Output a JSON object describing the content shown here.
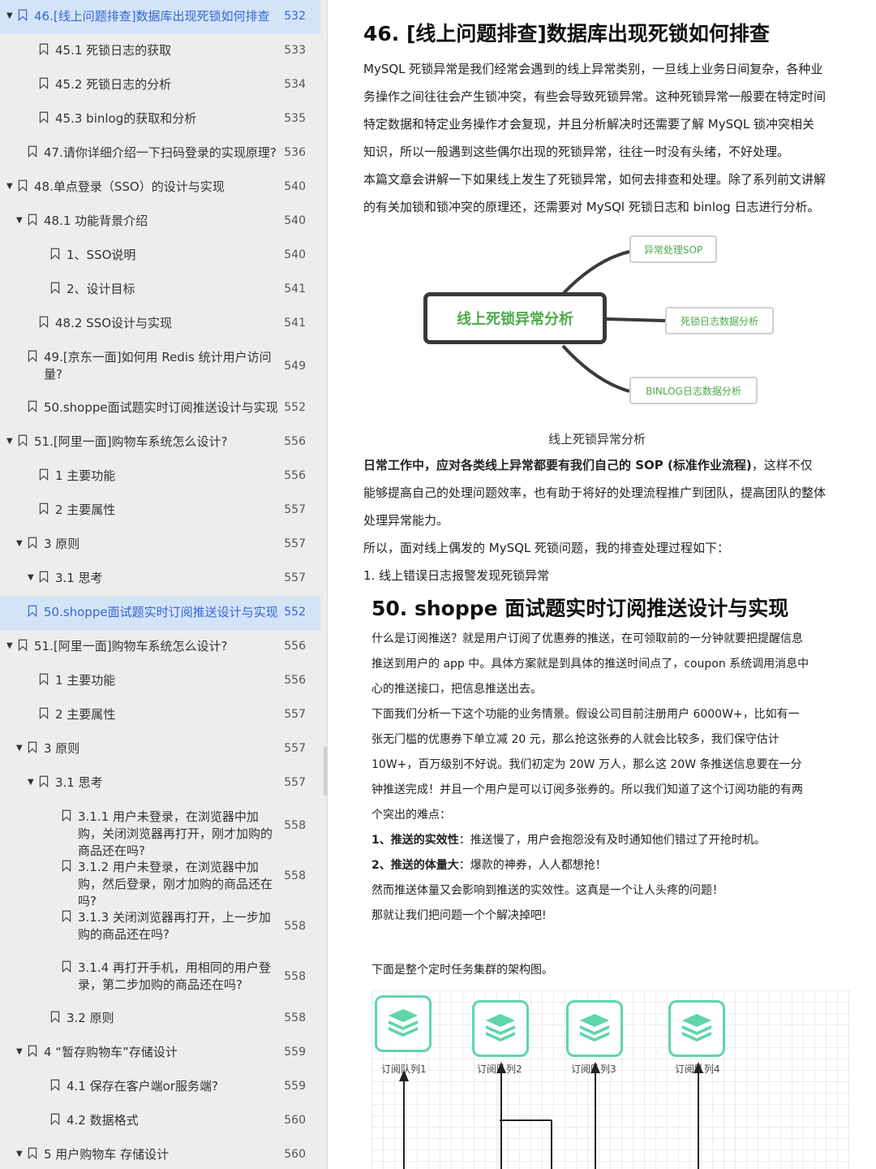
{
  "toc": [
    {
      "label": "46.[线上问题排查]数据库出现死锁如何排查",
      "page": "532",
      "level": 0,
      "arrow": "▼",
      "active": true
    },
    {
      "label": "45.1 死锁日志的获取",
      "page": "533",
      "level": 2
    },
    {
      "label": "45.2 死锁日志的分析",
      "page": "534",
      "level": 2
    },
    {
      "label": "45.3 binlog的获取和分析",
      "page": "535",
      "level": 2
    },
    {
      "label": "47.请你详细介绍一下扫码登录的实现原理?",
      "page": "536",
      "level": 1
    },
    {
      "label": "48.单点登录（SSO）的设计与实现",
      "page": "540",
      "level": 0,
      "arrow": "▼"
    },
    {
      "label": "48.1 功能背景介绍",
      "page": "540",
      "level": 1,
      "arrow": "▼"
    },
    {
      "label": "1、SSO说明",
      "page": "540",
      "level": 3
    },
    {
      "label": "2、设计目标",
      "page": "541",
      "level": 3
    },
    {
      "label": "48.2 SSO设计与实现",
      "page": "541",
      "level": 2
    },
    {
      "label": "49.[京东一面]如何用 Redis 统计用户访问量?",
      "page": "549",
      "level": 1,
      "wrap": true
    },
    {
      "label": "50.shoppe面试题实时订阅推送设计与实现",
      "page": "552",
      "level": 1
    },
    {
      "label": "51.[阿里一面]购物车系统怎么设计?",
      "page": "556",
      "level": 0,
      "arrow": "▼"
    },
    {
      "label": "1 主要功能",
      "page": "556",
      "level": 2
    },
    {
      "label": "2 主要属性",
      "page": "557",
      "level": 2
    },
    {
      "label": "3 原则",
      "page": "557",
      "level": 1,
      "arrow": "▼"
    },
    {
      "label": "3.1 思考",
      "page": "557",
      "level": 2,
      "arrow": "▼"
    },
    {
      "label": "50.shoppe面试题实时订阅推送设计与实现",
      "page": "552",
      "level": 1,
      "active": true
    },
    {
      "label": "51.[阿里一面]购物车系统怎么设计?",
      "page": "556",
      "level": 0,
      "arrow": "▼"
    },
    {
      "label": "1 主要功能",
      "page": "556",
      "level": 2
    },
    {
      "label": "2 主要属性",
      "page": "557",
      "level": 2
    },
    {
      "label": "3 原则",
      "page": "557",
      "level": 1,
      "arrow": "▼"
    },
    {
      "label": "3.1 思考",
      "page": "557",
      "level": 2,
      "arrow": "▼"
    },
    {
      "label": "3.1.1 用户未登录，在浏览器中加购，关闭浏览器再打开，刚才加购的商品还在吗?",
      "page": "558",
      "level": 4,
      "wrap": true
    },
    {
      "label": "3.1.2 用户未登录，在浏览器中加购，然后登录，刚才加购的商品还在吗?",
      "page": "558",
      "level": 4,
      "wrap": true
    },
    {
      "label": "3.1.3 关闭浏览器再打开，上一步加购的商品还在吗?",
      "page": "558",
      "level": 4,
      "wrap": true
    },
    {
      "label": "3.1.4 再打开手机，用相同的用户登录，第二步加购的商品还在吗?",
      "page": "558",
      "level": 4,
      "wrap": true
    },
    {
      "label": "3.2 原则",
      "page": "558",
      "level": 3
    },
    {
      "label": "4 “暂存购物车”存储设计",
      "page": "559",
      "level": 1,
      "arrow": "▼"
    },
    {
      "label": "4.1 保存在客户端or服务端?",
      "page": "559",
      "level": 3
    },
    {
      "label": "4.2 数据格式",
      "page": "560",
      "level": 3
    },
    {
      "label": "5 用户购物车 存储设计",
      "page": "560",
      "level": 1,
      "arrow": "▼"
    }
  ],
  "doc": {
    "h46": "46. [线上问题排查]数据库出现死锁如何排查",
    "p46": [
      "MySQL 死锁异常是我们经常会遇到的线上异常类别，一旦线上业务日间复杂，各种业",
      "务操作之间往往会产生锁冲突，有些会导致死锁异常。这种死锁异常一般要在特定时间",
      "特定数据和特定业务操作才会复现，并且分析解决时还需要了解 MySQL 锁冲突相关",
      "知识，所以一般遇到这些偶尔出现的死锁异常，往往一时没有头绪，不好处理。",
      "本篇文章会讲解一下如果线上发生了死锁异常，如何去排查和处理。除了系列前文讲解",
      "的有关加锁和锁冲突的原理还，还需要对 MySQl 死锁日志和 binlog 日志进行分析。"
    ],
    "mindmap": {
      "center": "线上死锁异常分析",
      "nodes": [
        "异常处理SOP",
        "死锁日志数据分析",
        "BINLOG日志数据分析"
      ],
      "caption": "线上死锁异常分析"
    },
    "sop_bold": "日常工作中，应对各类线上异常都要有我们自己的 SOP (标准作业流程)",
    "sop_rest": "，这样不仅",
    "p_sop": [
      "能够提高自己的处理问题效率，也有助于将好的处理流程推广到团队，提高团队的整体",
      "处理异常能力。",
      "所以，面对线上偶发的 MySQL 死锁问题，我的排查处理过程如下："
    ],
    "step1": "1.   线上错误日志报警发现死锁异常",
    "h50": "50. shoppe 面试题实时订阅推送设计与实现",
    "p50": [
      "什么是订阅推送？就是用户订阅了优惠券的推送，在可领取前的一分钟就要把提醒信息",
      "推送到用户的 app 中。具体方案就是到具体的推送时间点了，coupon 系统调用消息中",
      "心的推送接口，把信息推送出去。",
      "下面我们分析一下这个功能的业务情景。假设公司目前注册用户 6000W+，比如有一",
      "张无门槛的优惠券下单立减 20 元，那么抢这张券的人就会比较多，我们保守估计",
      "10W+，百万级别不好说。我们初定为 20W 万人，那么这 20W 条推送信息要在一分",
      "钟推送完成！并且一个用户是可以订阅多张券的。所以我们知道了这个订阅功能的有两",
      "个突出的难点："
    ],
    "point1_bold": "1、推送的实效性",
    "point1_rest": "：推送慢了，用户会抱怨没有及时通知他们错过了开抢时机。",
    "point2_bold": "2、推送的体量大",
    "point2_rest": "：爆款的神券，人人都想抢！",
    "p50_end": [
      "然而推送体量又会影响到推送的实效性。这真是一个让人头疼的问题！",
      "那就让我们把问题一个个解决掉吧!"
    ],
    "arch_intro": "下面是整个定时任务集群的架构图。",
    "queues": [
      "订阅队列1",
      "订阅队列2",
      "订阅队列3",
      "订阅队列4"
    ]
  },
  "colors": {
    "accent": "#3565d6",
    "active_bg": "#d4e4f7",
    "green": "#4caa4c",
    "teal": "#5ed6a8"
  }
}
